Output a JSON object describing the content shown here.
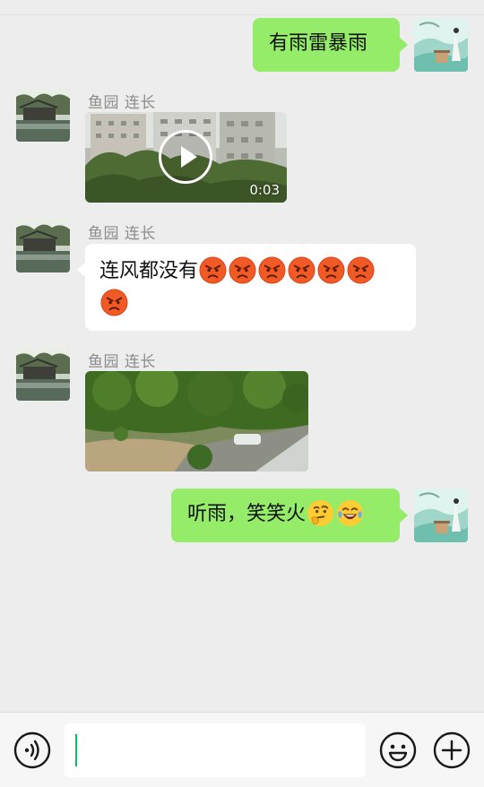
{
  "messages": [
    {
      "side": "right",
      "text": "有雨雷暴雨"
    },
    {
      "side": "left",
      "sender": "鱼园  连长",
      "video_duration": "0:03"
    },
    {
      "side": "left",
      "sender": "鱼园  连长",
      "text": "连风都没有"
    },
    {
      "side": "left",
      "sender": "鱼园  连长"
    },
    {
      "side": "right",
      "text": "听雨，笑笑火"
    }
  ],
  "emojis": {
    "angry": "angry-face-emoji",
    "thinking": "thinking-face-emoji",
    "laughing": "tears-of-joy-emoji",
    "angry_count": 7
  },
  "input": {
    "value": ""
  },
  "colors": {
    "background": "#ededed",
    "bubble_self": "#95ec69",
    "bubble_other": "#ffffff",
    "caret": "#07c160"
  }
}
